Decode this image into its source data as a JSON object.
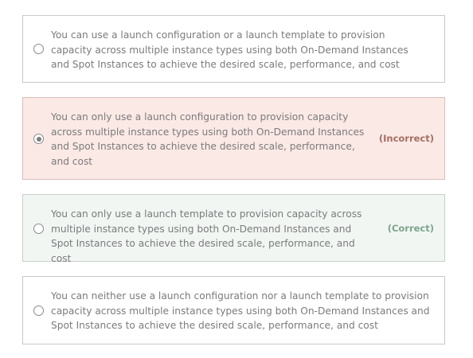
{
  "options": [
    {
      "text": "You can use a launch configuration or a launch template to provision capacity across multiple instance types using both On-Demand Instances and Spot Instances to achieve the desired scale, performance, and cost",
      "selected": false,
      "status": ""
    },
    {
      "text": "You can only use a launch configuration to provision capacity across multiple instance types using both On-Demand Instances and Spot Instances to achieve the desired scale, performance, and cost",
      "selected": true,
      "status": "(Incorrect)"
    },
    {
      "text": "You can only use a launch template to provision capacity across multiple instance types using both On-Demand Instances and Spot Instances to achieve the desired scale, performance, and cost",
      "selected": false,
      "status": "(Correct)"
    },
    {
      "text": "You can neither use a launch configuration nor a launch template to provision capacity across multiple instance types using both On-Demand Instances and Spot Instances to achieve the desired scale, performance, and cost",
      "selected": false,
      "status": ""
    }
  ],
  "colors": {
    "incorrect_bg": "#fbe9e6",
    "correct_bg": "#f1f6f3",
    "incorrect_text": "#a56f63",
    "correct_text": "#7ca58b"
  }
}
